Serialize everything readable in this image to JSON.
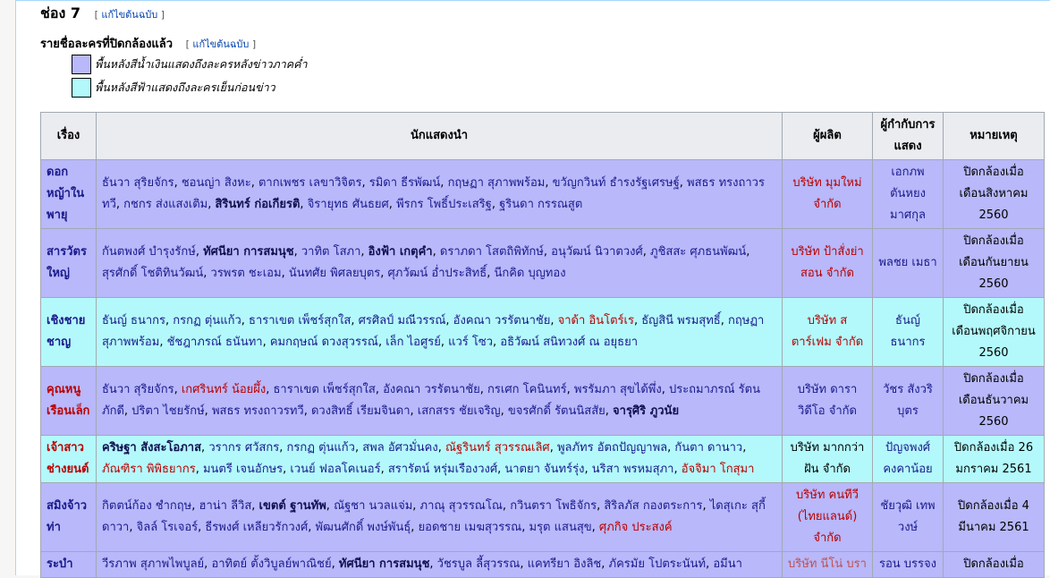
{
  "section_title": "ช่อง 7",
  "edit_label": "แก้ไขต้นฉบับ",
  "subsection_title": "รายชื่อละครที่ปิดกล้องแล้ว",
  "legend": [
    {
      "color": "#b8b8fb",
      "text": "พื้นหลังสีน้ำเงินแสดงถึงละครหลังข่าวภาคค่ำ"
    },
    {
      "color": "#b3f9fb",
      "text": "พื้นหลังสีฟ้าแสดงถึงละครเย็นก่อนข่าว"
    }
  ],
  "table": {
    "headers": [
      "เรื่อง",
      "นักแสดงนำ",
      "ผู้ผลิต",
      "ผู้กำกับการแสดง",
      "หมายเหตุ"
    ],
    "rows": [
      {
        "type": "night",
        "title": "ดอกหญ้าในพายุ",
        "title_red": false,
        "cast": [
          [
            "ธันวา สุริยจักร",
            "l"
          ],
          [
            "ชอนญ่า สิงหะ",
            "l"
          ],
          [
            "ตากเพชร เลขาวิจิตร",
            "l"
          ],
          [
            "รมิดา ธีรพัฒน์",
            "l"
          ],
          [
            "กฤษฏา สุภาพพร้อม",
            "l"
          ],
          [
            "ขวัญกวินท์ ธำรงรัฐเศรษฐ์",
            "l"
          ],
          [
            "พสธร ทรงถาวรทวี",
            "l"
          ],
          [
            "กชกร ส่งแสงเติม",
            "l"
          ],
          [
            "สิรินทร์ ก่อเกียรติ",
            "b"
          ],
          [
            "จิรายุทธ ศันธยศ",
            "l"
          ],
          [
            "พีรกร โพธิ์ประเสริฐ",
            "l"
          ],
          [
            "ฐรินดา กรรณสูต",
            "l"
          ]
        ],
        "producer": "บริษัท มุมใหม่ จำกัด",
        "producer_c": "r",
        "director": "เอกภพ ตันหยง มาศกุล",
        "note": "ปิดกล้องเมื่อ เดือนสิงหาคม 2560"
      },
      {
        "type": "night",
        "title": "สารวัตรใหญ่",
        "title_red": false,
        "cast": [
          [
            "กันตพงศ์ บำรุงรักษ์",
            "l"
          ],
          [
            "ทัศนียา การสมนุช",
            "b"
          ],
          [
            "วาทิต โสภา",
            "l"
          ],
          [
            "อิงฟ้า เกตุคำ",
            "b"
          ],
          [
            "ดราภดา โสตถิพิทักษ์",
            "l"
          ],
          [
            "อนุวัฒน์ นิวาตวงศ์",
            "l"
          ],
          [
            "ภูชิสสะ ศุภธนพัฒน์",
            "l"
          ],
          [
            "สุรศักดิ์ โชติทินวัฒน์",
            "l"
          ],
          [
            "วรพรต ชะเอม",
            "l"
          ],
          [
            "นันทศัย พิศลยบุตร",
            "l"
          ],
          [
            "ศุภวัฒน์ อ่ำประสิทธิ์",
            "l"
          ],
          [
            "นีกคิด บุญทอง",
            "l"
          ]
        ],
        "producer": "บริษัท ป้าสั่งย่าสอน จำกัด",
        "producer_c": "r",
        "director": "พลชย เมธา",
        "note": "ปิดกล้องเมื่อ เดือนกันยายน 2560"
      },
      {
        "type": "evening",
        "title": "เชิงชายชาญ",
        "title_red": false,
        "cast": [
          [
            "ธันญ์ ธนากร",
            "l"
          ],
          [
            "กรกฏ ตุ่นแก้ว",
            "l"
          ],
          [
            "ธาราเขต เพ็ชร์สุกใส",
            "l"
          ],
          [
            "ศรศิลป์ มณีวรรณ์",
            "l"
          ],
          [
            "อังคณา วรรัตนาชัย",
            "l"
          ],
          [
            "จาด้า อินโตร์เร",
            "r"
          ],
          [
            "ธัญสินี พรมสุทธิ์",
            "l"
          ],
          [
            "กฤษฏา สุภาพพร้อม",
            "l"
          ],
          [
            "ชัชฎาภรณ์ ธนันทา",
            "l"
          ],
          [
            "คมกฤษณ์ ดวงสุวรรณ์",
            "l"
          ],
          [
            "เล็ก ไอศูรย์",
            "l"
          ],
          [
            "แวร์ โซว",
            "l"
          ],
          [
            "อธิวัฒน์ สนิทวงศ์ ณ อยุธยา",
            "l"
          ]
        ],
        "producer": "บริษัท สตาร์เฟม จำกัด",
        "producer_c": "r",
        "director": "ธันญ์ ธนากร",
        "note": "ปิดกล้องเมื่อ เดือนพฤศจิกายน 2560"
      },
      {
        "type": "night",
        "title": "คุณหนูเรือนเล็ก",
        "title_red": true,
        "cast": [
          [
            "ธันวา สุริยจักร",
            "l"
          ],
          [
            "เกศรินทร์ น้อยผึ้ง",
            "r"
          ],
          [
            "ธาราเขต เพ็ชร์สุกใส",
            "l"
          ],
          [
            "อังคณา วรรัตนาชัย",
            "l"
          ],
          [
            "กรเศก โคนินทร์",
            "l"
          ],
          [
            "พรรัมภา สุขได้พึ่ง",
            "l"
          ],
          [
            "ประถมาภรณ์ รัตนภักดี",
            "l"
          ],
          [
            "ปริตา ไชยรักษ์",
            "l"
          ],
          [
            "พสธร ทรงถาวรทวี",
            "l"
          ],
          [
            "ดวงสิทธิ์ เรียมจินดา",
            "l"
          ],
          [
            "เสกสรร ชัยเจริญ",
            "l"
          ],
          [
            "ขจรศักดิ์ รัตนนิสสัย",
            "l"
          ],
          [
            "จารุศิริ ภูวนัย",
            "b"
          ]
        ],
        "producer": "บริษัท ดารา วิดีโอ จำกัด",
        "producer_c": "l",
        "director": "วัชร สังวริบุตร",
        "note": "ปิดกล้องเมื่อ เดือนธันวาคม 2560"
      },
      {
        "type": "evening",
        "title": "เจ้าสาวช่างยนต์",
        "title_red": true,
        "cast": [
          [
            "คริษฐา สังสะโอภาส",
            "b"
          ],
          [
            "วรากร ศวัสกร",
            "l"
          ],
          [
            "กรกฏ ตุ่นแก้ว",
            "l"
          ],
          [
            "สพล อัศวมั่นคง",
            "l"
          ],
          [
            "ณัฐรินทร์ สุวรรณเลิศ",
            "r"
          ],
          [
            "พูลภัทร อัตถปัญญาพล",
            "l"
          ],
          [
            "กันตา ดานาว",
            "l"
          ],
          [
            "ภัณฑิรา พิพิธยากร",
            "r"
          ],
          [
            "มนตรี เจนอักษร",
            "l"
          ],
          [
            "เวนย์ ฟอลโคเนอร์",
            "l"
          ],
          [
            "สรารัตน์ หรุ่มเรืองวงศ์",
            "l"
          ],
          [
            "นาตยา จันทร์รุ่ง",
            "l"
          ],
          [
            "นริสา พรหมสุภา",
            "l"
          ],
          [
            "อัจจิมา โกสุมา",
            "r"
          ]
        ],
        "producer": "บริษัท มากกว่าฝัน จำกัด",
        "producer_c": "b0",
        "director": "ปัญจพงศ์ คงคาน้อย",
        "note": "ปิดกล้องเมื่อ 26 มกราคม 2561"
      },
      {
        "type": "night",
        "title": "สมิงจ้าวท่า",
        "title_red": false,
        "cast": [
          [
            "กิตตน์ก้อง ชำกฤษ",
            "l"
          ],
          [
            "ฮาน่า ลีวิส",
            "l"
          ],
          [
            "เขตต์ ฐานทัพ",
            "b"
          ],
          [
            "ณัฐชา นวลแจ่ม",
            "l"
          ],
          [
            "ภาณุ สุวรรณโณ",
            "l"
          ],
          [
            "กวินตรา โพธิจักร",
            "l"
          ],
          [
            "สิริลภัส กองตระการ",
            "l"
          ],
          [
            "ไดสุเกะ สุกี้ดาวา",
            "l"
          ],
          [
            "จิลล์ โรเจอร์",
            "l"
          ],
          [
            "ธีรพงศ์ เหลียวรักวงศ์",
            "l"
          ],
          [
            "พัฒนศักดิ์ พงษ์พันธุ์",
            "l"
          ],
          [
            "ยอดชาย เมฆสุวรรณ",
            "l"
          ],
          [
            "มรุต แสนสุข",
            "l"
          ],
          [
            "ศุภกิจ ประสงค์",
            "r"
          ]
        ],
        "producer": "บริษัท คนทีวี (ไทยแลนด์) จำกัด",
        "producer_c": "r",
        "director": "ชัยวุฒิ เทพวงษ์",
        "note": "ปิดกล้องเมื่อ 4 มีนาคม 2561"
      },
      {
        "type": "night",
        "title": "ระบำ",
        "title_red": false,
        "cast": [
          [
            "วีรภาพ สุภาพไพบูลย์",
            "l"
          ],
          [
            "อาทิตย์ ตั้งวิบูลย์พาณิชย์",
            "l"
          ],
          [
            "ทัศนียา การสมนุช",
            "b"
          ],
          [
            "วัชรบูล ลี้สุวรรณ",
            "l"
          ],
          [
            "แคทรียา อิงลิช",
            "l"
          ],
          [
            "ภัครมัย โปตระนันท์",
            "l"
          ],
          [
            "อมีนา",
            "l"
          ]
        ],
        "producer": "บริษัท นีโน่ บรา",
        "producer_c": "o",
        "director": "รอน บรรจง",
        "note": "ปิดกล้องเมื่อ"
      }
    ]
  }
}
